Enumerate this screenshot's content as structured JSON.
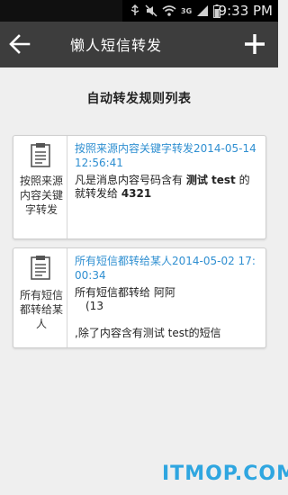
{
  "status_bar": {
    "time": "9:33 PM",
    "network_label": "3G",
    "icons": [
      "usb-icon",
      "mute-icon",
      "wifi-icon",
      "signal-icon",
      "battery-icon"
    ]
  },
  "action_bar": {
    "title": "懒人短信转发",
    "back_icon": "arrow-left-icon",
    "add_icon": "plus-icon"
  },
  "list_title": "自动转发规则列表",
  "rules": [
    {
      "type_label": "按照来源内容关键字转发",
      "name": "按照来源内容关键字转发2014-05-14 12:56:41",
      "desc_prefix": "凡是消息内容号码含有 ",
      "desc_keyword": "测试 test",
      "desc_mid": " 的就转发给 ",
      "desc_target": "4321"
    },
    {
      "type_label": "所有短信都转给某人",
      "name": "所有短信都转给某人2014-05-02 17:00:34",
      "desc_line1": "所有短信都转给 阿阿",
      "desc_line2": "(13",
      "desc_line3": ",除了内容含有测试 test的短信"
    }
  ],
  "watermark": "ITMOP.COM",
  "colors": {
    "action_bar": "#3d3d3d",
    "rule_name": "#2f8fd1",
    "watermark": "#2fa6e0",
    "background": "#efefef"
  }
}
